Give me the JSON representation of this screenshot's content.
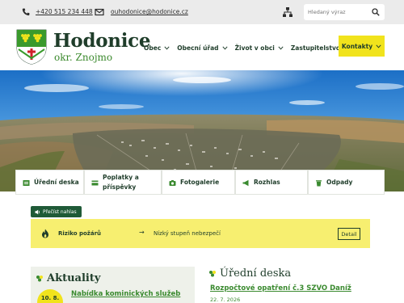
{
  "topbar": {
    "phone": "+420 515 234 448",
    "email": "ouhodonice@hodonice.cz",
    "search_placeholder": "Hledaný výraz"
  },
  "brand": {
    "title": "Hodonice",
    "subtitle": "okr. Znojmo"
  },
  "nav": {
    "items": [
      {
        "label": "Obec"
      },
      {
        "label": "Obecní úřad"
      },
      {
        "label": "Život v obci"
      },
      {
        "label": "Zastupitelstvo"
      }
    ],
    "contact_label": "Kontakty"
  },
  "quick_links": [
    {
      "label": "Úřední deska",
      "icon": "board-icon"
    },
    {
      "label": "Poplatky a příspěvky",
      "icon": "payment-icon"
    },
    {
      "label": "Fotogalerie",
      "icon": "camera-icon"
    },
    {
      "label": "Rozhlas",
      "icon": "megaphone-icon"
    },
    {
      "label": "Odpady",
      "icon": "trash-icon"
    }
  ],
  "read_aloud": {
    "label": "Přečíst nahlas"
  },
  "fire_risk": {
    "title": "Riziko požárů",
    "arrow": "→",
    "level": "Nízký stupeň nebezpečí",
    "detail_label": "Detail"
  },
  "news": {
    "title": "Aktuality",
    "items": [
      {
        "date": "10. 8.",
        "title": "Nabídka kominických služeb"
      }
    ]
  },
  "board": {
    "title": "Úřední deska",
    "items": [
      {
        "title": "Rozpočtové opatření č.3 SZVO Daníž",
        "date": "22. 7. 2026"
      }
    ]
  },
  "colors": {
    "brand_dark": "#1f3d2a",
    "accent_green": "#3a8a2f",
    "accent_yellow": "#f1e31c",
    "alert_yellow": "#f7ef70",
    "topbar_gray": "#ebebeb"
  }
}
